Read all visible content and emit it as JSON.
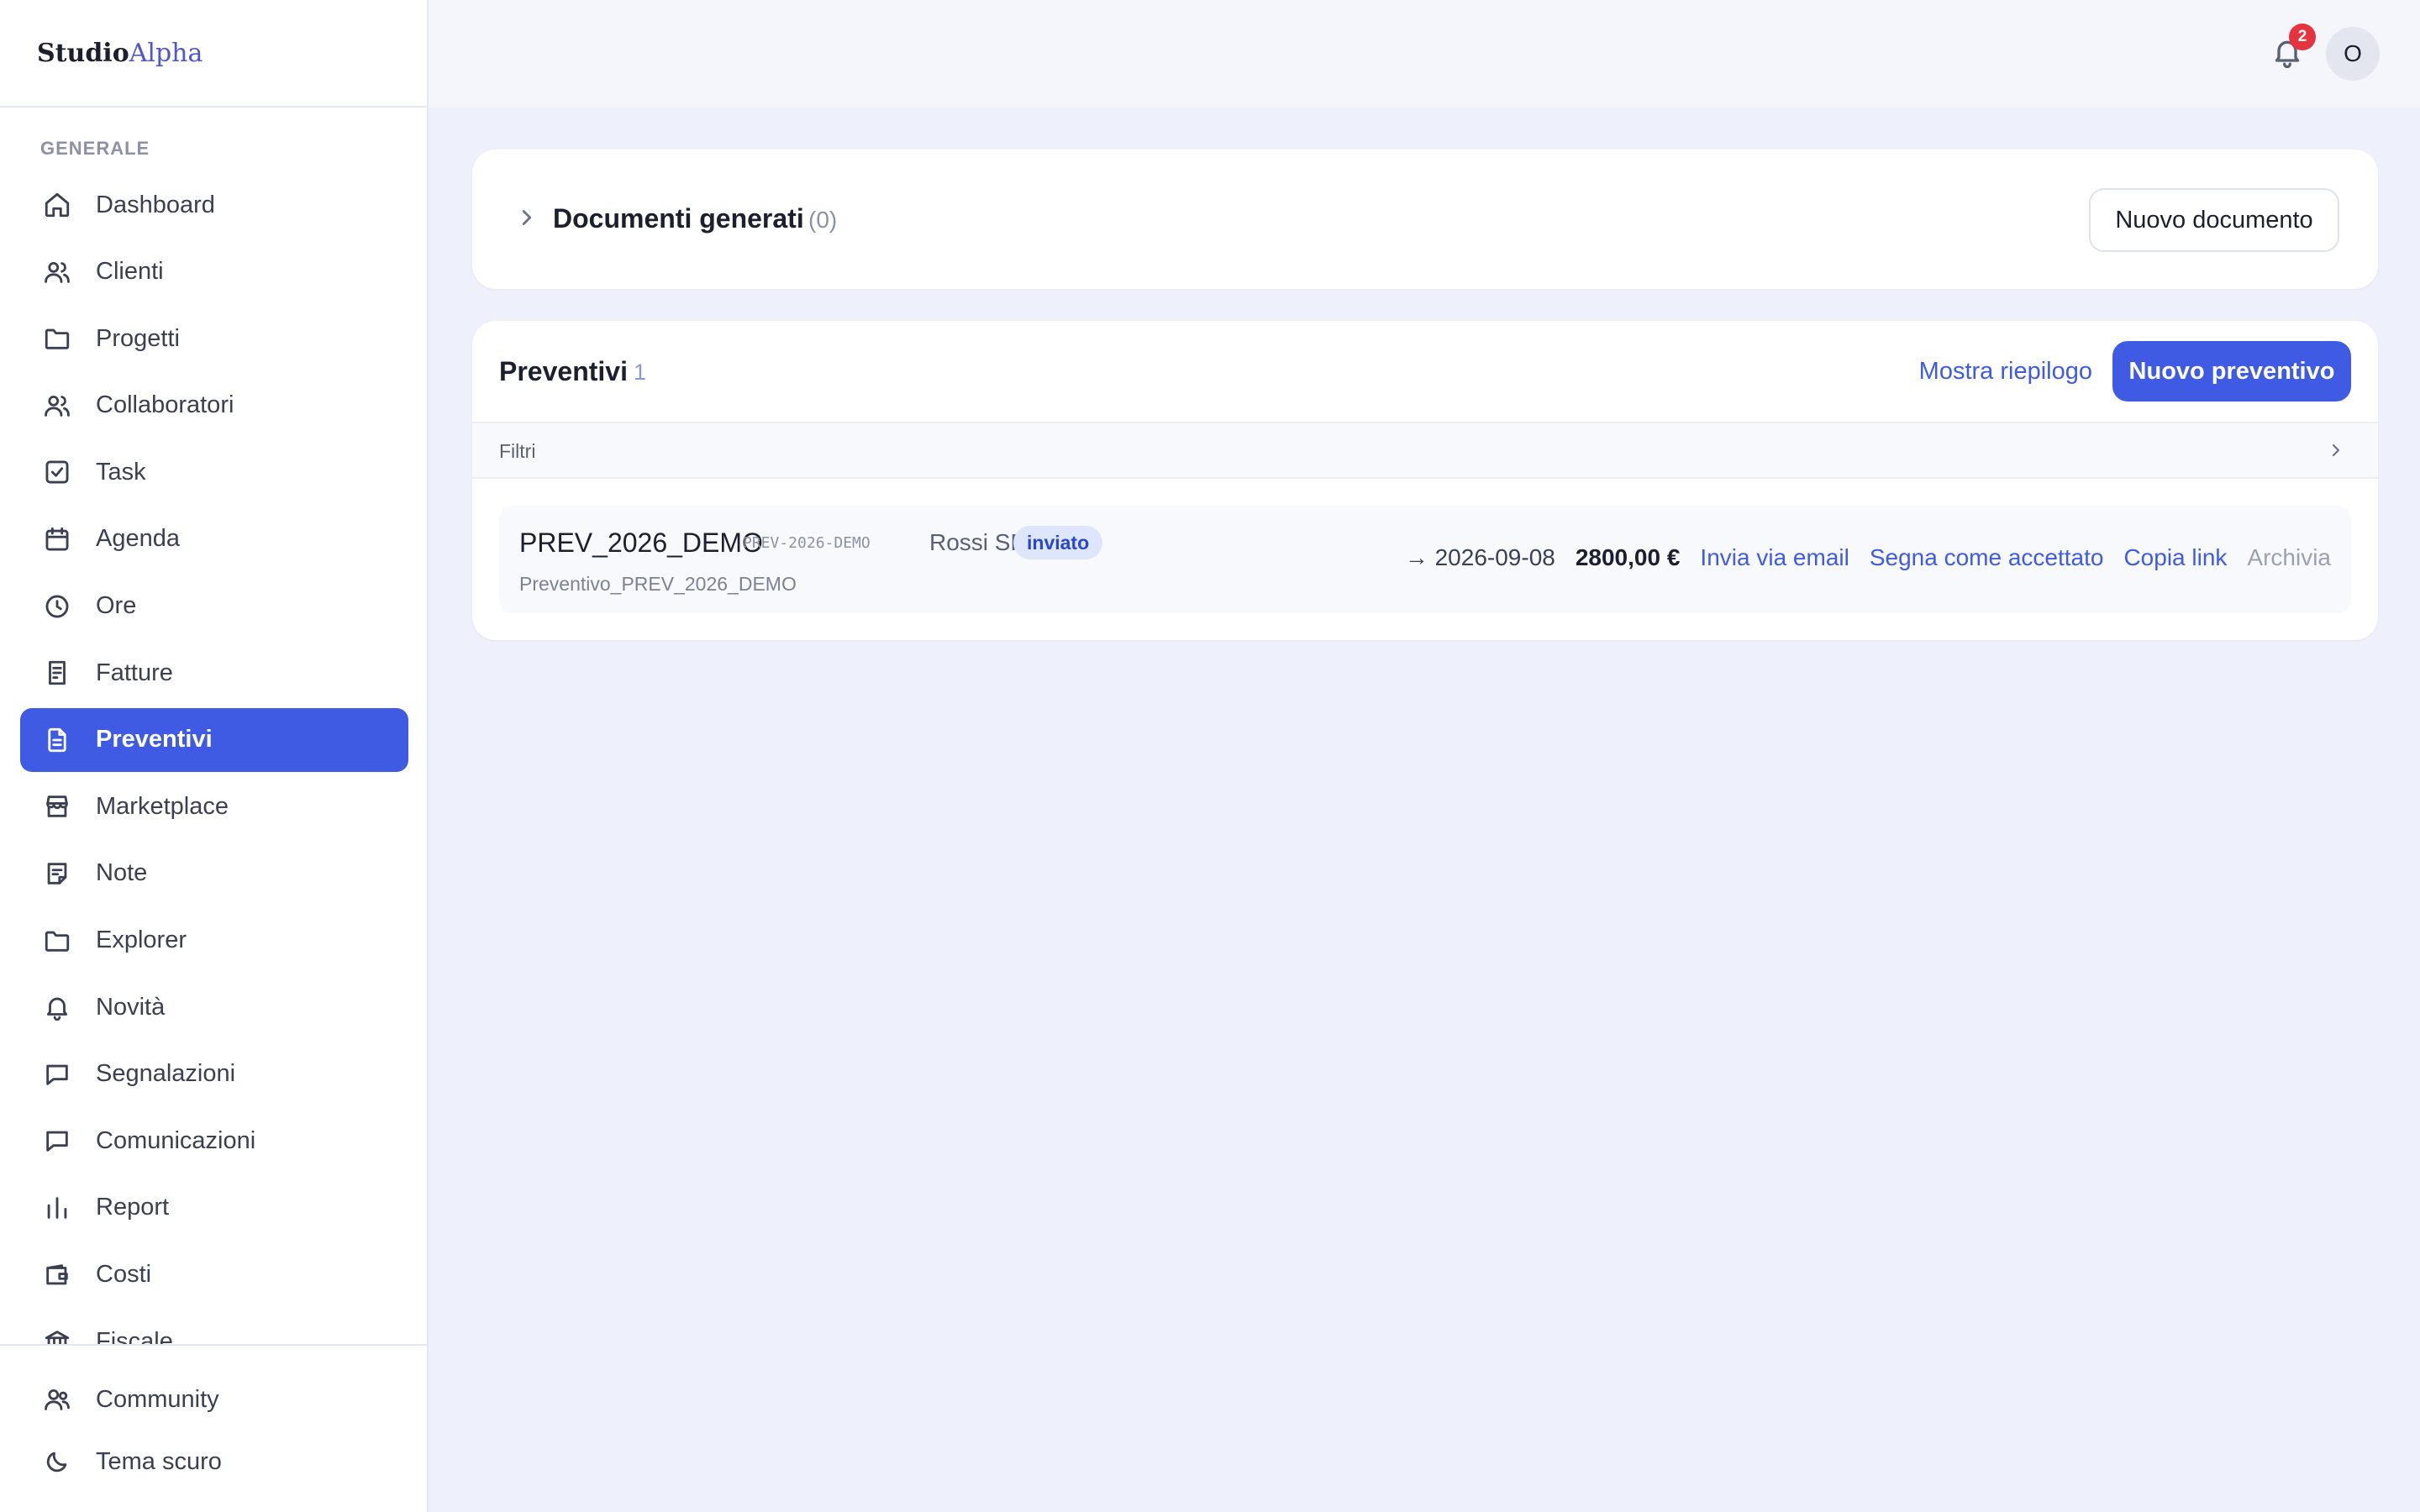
{
  "brand": {
    "part1": "Studio",
    "part2": "Alpha"
  },
  "sidebar": {
    "section_label": "GENERALE",
    "items": [
      {
        "label": "Dashboard",
        "icon": "home-icon"
      },
      {
        "label": "Clienti",
        "icon": "users-icon"
      },
      {
        "label": "Progetti",
        "icon": "folder-icon"
      },
      {
        "label": "Collaboratori",
        "icon": "users-icon"
      },
      {
        "label": "Task",
        "icon": "check-square-icon"
      },
      {
        "label": "Agenda",
        "icon": "calendar-icon"
      },
      {
        "label": "Ore",
        "icon": "clock-icon"
      },
      {
        "label": "Fatture",
        "icon": "receipt-icon"
      },
      {
        "label": "Preventivi",
        "icon": "file-text-icon",
        "active": true
      },
      {
        "label": "Marketplace",
        "icon": "store-icon"
      },
      {
        "label": "Note",
        "icon": "note-icon"
      },
      {
        "label": "Explorer",
        "icon": "folder-icon"
      },
      {
        "label": "Novità",
        "icon": "bell-icon"
      },
      {
        "label": "Segnalazioni",
        "icon": "message-icon"
      },
      {
        "label": "Comunicazioni",
        "icon": "message-icon"
      },
      {
        "label": "Report",
        "icon": "bar-chart-icon"
      },
      {
        "label": "Costi",
        "icon": "wallet-icon"
      },
      {
        "label": "Fiscale",
        "icon": "bank-icon"
      }
    ],
    "bottom": {
      "community": "Community",
      "theme": "Tema scuro"
    }
  },
  "topbar": {
    "notifications_count": "2",
    "avatar_initial": "O"
  },
  "documents": {
    "title": "Documenti generati",
    "count": "(0)",
    "new_button": "Nuovo documento"
  },
  "quotes": {
    "title": "Preventivi",
    "count": "1",
    "summary_link": "Mostra riepilogo",
    "new_button": "Nuovo preventivo",
    "filters_label": "Filtri",
    "rows": [
      {
        "name": "PREV_2026_DEMO",
        "code": "PREV-2026-DEMO",
        "client": "Rossi SRL",
        "status": "inviato",
        "subtitle": "Preventivo_PREV_2026_DEMO",
        "date": "→ 2026-09-08",
        "amount": "2800,00 €",
        "action_email": "Invia via email",
        "action_accept": "Segna come accettato",
        "action_copy": "Copia link",
        "action_archive": "Archivia"
      }
    ]
  },
  "colors": {
    "accent": "#3f5be4",
    "background": "#eef1fb",
    "badge": "#e5343f"
  }
}
